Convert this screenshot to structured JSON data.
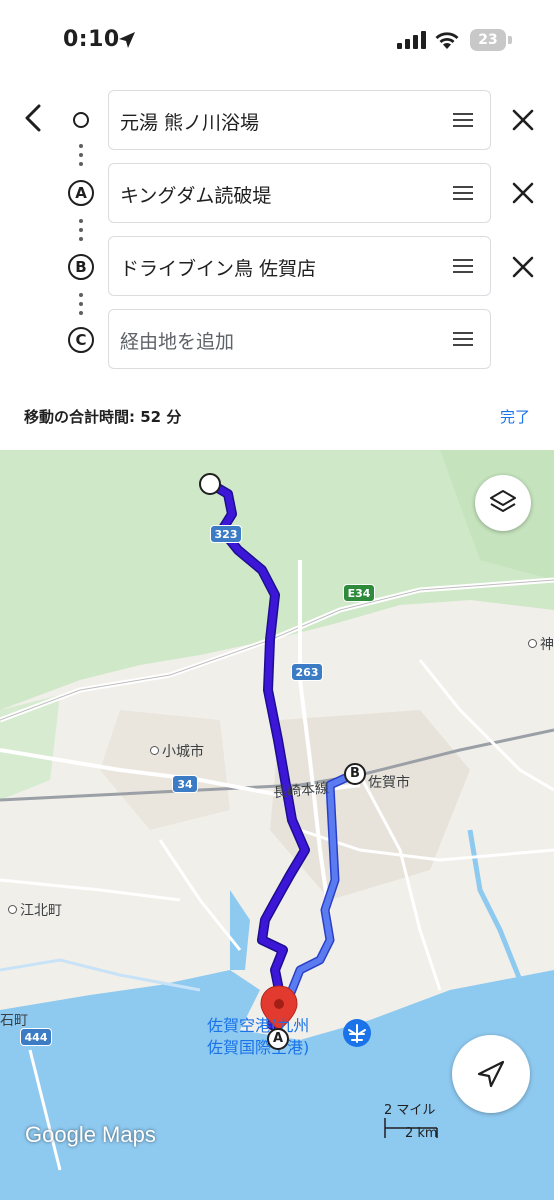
{
  "status_bar": {
    "time": "0:10",
    "battery": "23"
  },
  "route_panel": {
    "stops": [
      {
        "marker": "",
        "value": "元湯 熊ノ川浴場"
      },
      {
        "marker": "A",
        "value": "キングダム読破堤"
      },
      {
        "marker": "B",
        "value": "ドライブイン鳥 佐賀店"
      },
      {
        "marker": "C",
        "value": "",
        "placeholder": "経由地を追加"
      }
    ],
    "total_time": "移動の合計時間: 52 分",
    "done_label": "完了"
  },
  "map": {
    "places": {
      "ogi": "小城市",
      "saga": "佐賀市",
      "kohoku": "江北町",
      "ishi": "石町",
      "kan": "神",
      "rail": "長崎本線"
    },
    "airport": [
      "佐賀空港(九州",
      "佐賀国際空港)"
    ],
    "route_shields": [
      "323",
      "263",
      "34",
      "444"
    ],
    "expressway_shield": "E34",
    "markers": {
      "a": "A",
      "b": "B"
    },
    "logo": "Google Maps",
    "scale": {
      "miles": "2 マイル",
      "km": "2 km"
    },
    "colors": {
      "route_primary": "#3d17d8",
      "route_alt": "#5b7cf0",
      "water": "#8ec9f0",
      "forest": "#cfe8c8",
      "pin": "#e33a2f"
    }
  }
}
